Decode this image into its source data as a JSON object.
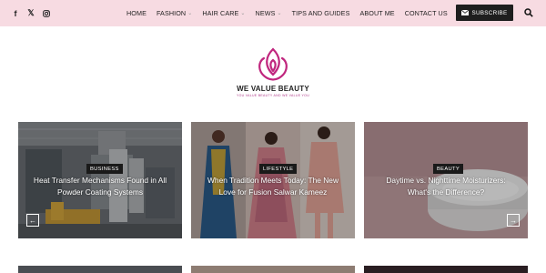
{
  "topbar": {
    "social": [
      {
        "name": "facebook-icon",
        "glyph": "f"
      },
      {
        "name": "x-icon",
        "glyph": "𝕏"
      },
      {
        "name": "instagram-icon",
        "glyph": ""
      }
    ],
    "nav": [
      {
        "label": "HOME",
        "dropdown": false
      },
      {
        "label": "FASHION",
        "dropdown": true
      },
      {
        "label": "HAIR CARE",
        "dropdown": true
      },
      {
        "label": "NEWS",
        "dropdown": true
      },
      {
        "label": "TIPS AND GUIDES",
        "dropdown": false
      },
      {
        "label": "ABOUT ME",
        "dropdown": false
      },
      {
        "label": "CONTACT US",
        "dropdown": false
      }
    ],
    "subscribe_label": "SUBSCRIBE",
    "background": "#f7dbe2"
  },
  "logo": {
    "name": "WE VALUE BEAUTY",
    "tagline": "YOU VALUE BEAUTY AND WE VALUE YOU",
    "color": "#c0267e"
  },
  "cards": [
    {
      "category": "BUSINESS",
      "title_line1": "Heat Transfer Mechanisms Found in All",
      "title_line2": "Powder Coating Systems"
    },
    {
      "category": "LIFESTYLE",
      "title_line1": "When Tradition Meets Today: The New",
      "title_line2": "Love for Fusion Salwar Kameez"
    },
    {
      "category": "BEAUTY",
      "title_line1": "Daytime vs. Nighttime Moisturizers:",
      "title_line2": "What's the Difference?"
    }
  ],
  "slider": {
    "prev": "←",
    "next": "→"
  }
}
